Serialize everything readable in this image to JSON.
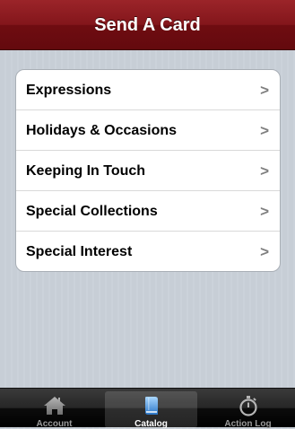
{
  "navbar": {
    "title": "Send A Card"
  },
  "menu": {
    "items": [
      {
        "label": "Expressions"
      },
      {
        "label": "Holidays & Occasions"
      },
      {
        "label": "Keeping In Touch"
      },
      {
        "label": "Special Collections"
      },
      {
        "label": "Special Interest"
      }
    ],
    "chevron": ">"
  },
  "tabbar": {
    "tabs": [
      {
        "label": "Account",
        "icon": "house-icon",
        "active": false
      },
      {
        "label": "Catalog",
        "icon": "book-icon",
        "active": true
      },
      {
        "label": "Action Log",
        "icon": "stopwatch-icon",
        "active": false
      }
    ]
  },
  "colors": {
    "navbar": "#83161b",
    "background": "#c5ccd4",
    "tabbar": "#000000",
    "active_icon": "#3a8ad6"
  }
}
